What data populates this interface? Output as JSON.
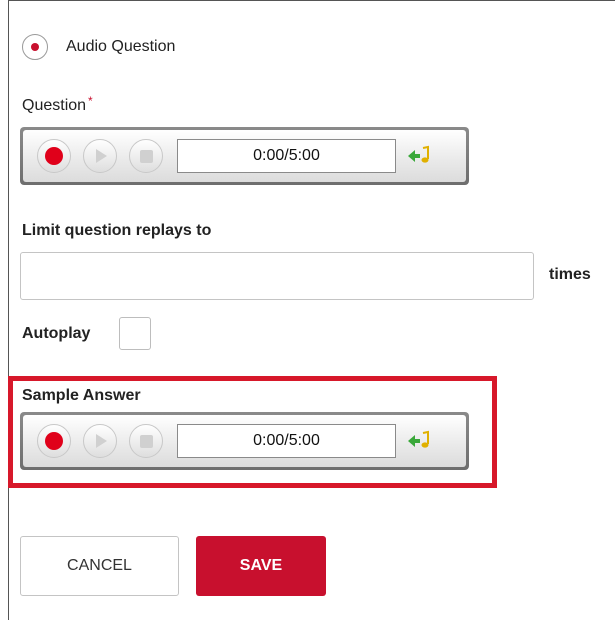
{
  "question_type": {
    "label": "Audio Question",
    "selected": true
  },
  "question": {
    "label": "Question",
    "required_marker": "*",
    "recorder": {
      "time": "0:00/5:00"
    }
  },
  "replays": {
    "label": "Limit question replays to",
    "value": "",
    "suffix": "times"
  },
  "autoplay": {
    "label": "Autoplay",
    "checked": false
  },
  "sample_answer": {
    "label": "Sample Answer",
    "recorder": {
      "time": "0:00/5:00"
    }
  },
  "buttons": {
    "cancel": "CANCEL",
    "save": "SAVE"
  },
  "colors": {
    "accent": "#c8102e",
    "highlight": "#d7182a",
    "record": "#e0001a"
  },
  "icons": [
    "record-icon",
    "play-icon",
    "stop-icon",
    "upload-audio-icon"
  ]
}
